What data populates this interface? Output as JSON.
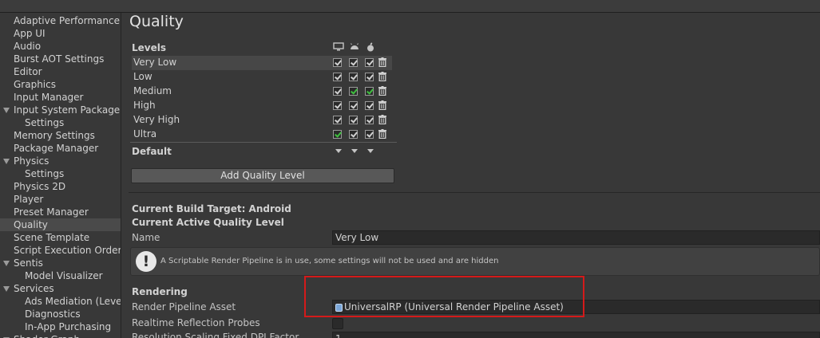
{
  "sidebar": {
    "items": [
      {
        "label": "Adaptive Performance",
        "indent": 0,
        "arrow": false,
        "selected": false
      },
      {
        "label": "App UI",
        "indent": 0,
        "arrow": false,
        "selected": false
      },
      {
        "label": "Audio",
        "indent": 0,
        "arrow": false,
        "selected": false
      },
      {
        "label": "Burst AOT Settings",
        "indent": 0,
        "arrow": false,
        "selected": false
      },
      {
        "label": "Editor",
        "indent": 0,
        "arrow": false,
        "selected": false
      },
      {
        "label": "Graphics",
        "indent": 0,
        "arrow": false,
        "selected": false
      },
      {
        "label": "Input Manager",
        "indent": 0,
        "arrow": false,
        "selected": false
      },
      {
        "label": "Input System Package",
        "indent": 0,
        "arrow": true,
        "selected": false
      },
      {
        "label": "Settings",
        "indent": 1,
        "arrow": false,
        "selected": false
      },
      {
        "label": "Memory Settings",
        "indent": 0,
        "arrow": false,
        "selected": false
      },
      {
        "label": "Package Manager",
        "indent": 0,
        "arrow": false,
        "selected": false
      },
      {
        "label": "Physics",
        "indent": 0,
        "arrow": true,
        "selected": false
      },
      {
        "label": "Settings",
        "indent": 1,
        "arrow": false,
        "selected": false
      },
      {
        "label": "Physics 2D",
        "indent": 0,
        "arrow": false,
        "selected": false
      },
      {
        "label": "Player",
        "indent": 0,
        "arrow": false,
        "selected": false
      },
      {
        "label": "Preset Manager",
        "indent": 0,
        "arrow": false,
        "selected": false
      },
      {
        "label": "Quality",
        "indent": 0,
        "arrow": false,
        "selected": true
      },
      {
        "label": "Scene Template",
        "indent": 0,
        "arrow": false,
        "selected": false
      },
      {
        "label": "Script Execution Order",
        "indent": 0,
        "arrow": false,
        "selected": false
      },
      {
        "label": "Sentis",
        "indent": 0,
        "arrow": true,
        "selected": false
      },
      {
        "label": "Model Visualizer",
        "indent": 1,
        "arrow": false,
        "selected": false
      },
      {
        "label": "Services",
        "indent": 0,
        "arrow": true,
        "selected": false
      },
      {
        "label": "Ads Mediation (Level",
        "indent": 1,
        "arrow": false,
        "selected": false
      },
      {
        "label": "Diagnostics",
        "indent": 1,
        "arrow": false,
        "selected": false
      },
      {
        "label": "In-App Purchasing",
        "indent": 1,
        "arrow": false,
        "selected": false
      },
      {
        "label": "Shader Graph",
        "indent": 0,
        "arrow": true,
        "selected": false
      }
    ]
  },
  "main": {
    "title": "Quality",
    "levels_header": "Levels",
    "platform_icons": [
      "desktop-icon",
      "android-icon",
      "apple-icon"
    ],
    "levels": [
      {
        "name": "Very Low",
        "selected": true,
        "defaults": [
          false,
          false,
          false
        ]
      },
      {
        "name": "Low",
        "selected": false,
        "defaults": [
          false,
          false,
          false
        ]
      },
      {
        "name": "Medium",
        "selected": false,
        "defaults": [
          false,
          true,
          true
        ]
      },
      {
        "name": "High",
        "selected": false,
        "defaults": [
          false,
          false,
          false
        ]
      },
      {
        "name": "Very High",
        "selected": false,
        "defaults": [
          false,
          false,
          false
        ]
      },
      {
        "name": "Ultra",
        "selected": false,
        "defaults": [
          true,
          false,
          false
        ]
      }
    ],
    "default_label": "Default",
    "add_button_label": "Add Quality Level",
    "build_target": "Current Build Target: Android",
    "active_level_heading": "Current Active Quality Level",
    "name_label": "Name",
    "name_value": "Very Low",
    "info_message": "A Scriptable Render Pipeline is in use, some settings will not be used and are hidden",
    "rendering_heading": "Rendering",
    "render_pipeline_label": "Render Pipeline Asset",
    "render_pipeline_value": "UniversalRP (Universal Render Pipeline Asset)",
    "reflection_probes_label": "Realtime Reflection Probes",
    "resolution_scaling_label": "Resolution Scaling Fixed DPI Factor",
    "resolution_scaling_value": "1"
  },
  "colors": {
    "default_check": "#3fbf3f",
    "highlight": "#d41a1a"
  }
}
